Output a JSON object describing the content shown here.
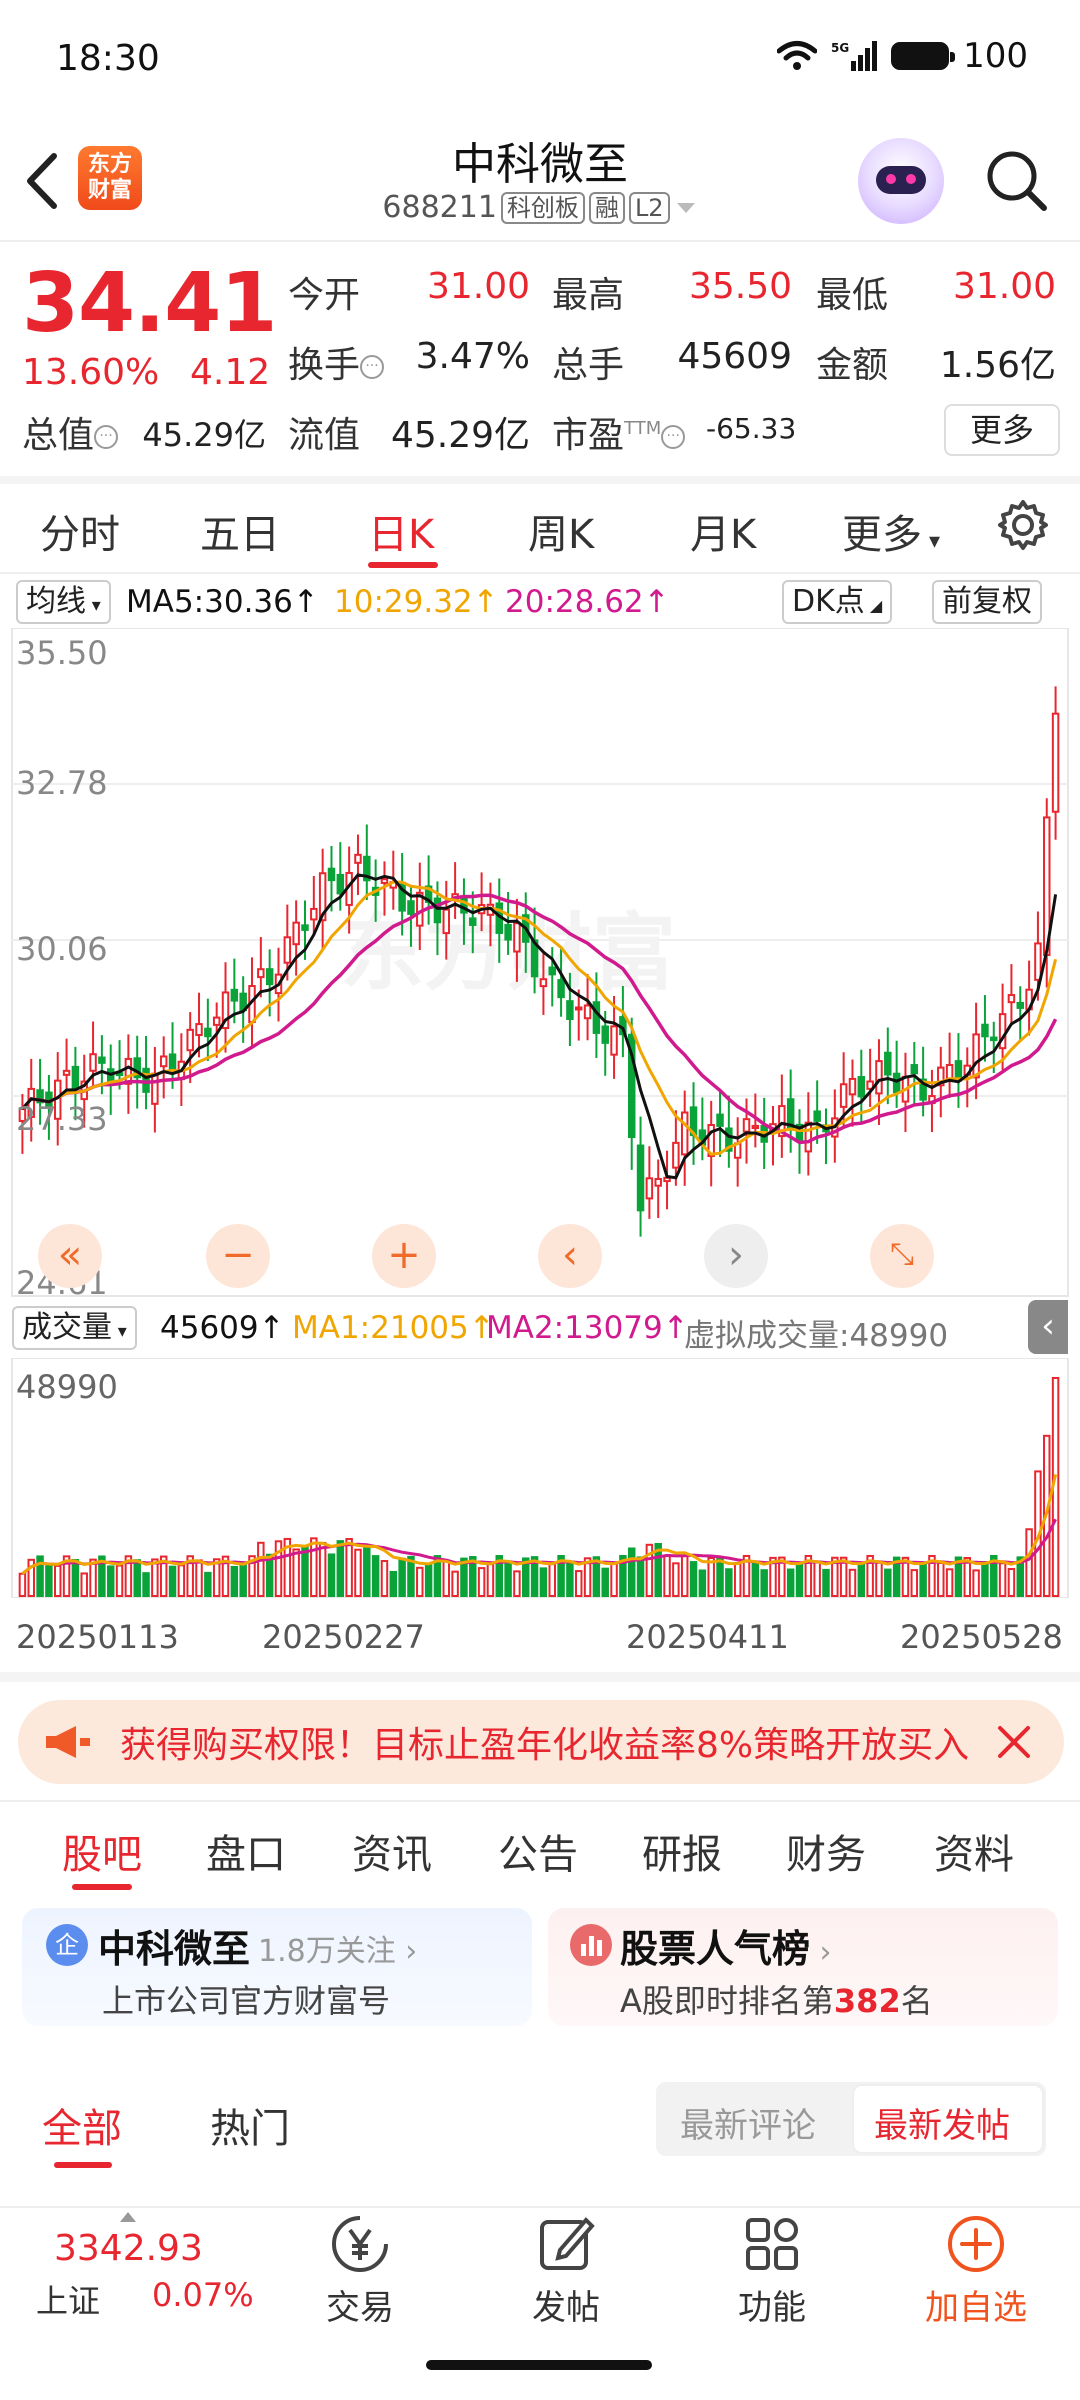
{
  "status_bar": {
    "time": "18:30",
    "network": "5G",
    "battery": "100"
  },
  "header": {
    "logo_text": "东方财富",
    "stock_name": "中科微至",
    "stock_code": "688211",
    "tags": [
      "科创板",
      "融",
      "L2"
    ]
  },
  "quote": {
    "price": "34.41",
    "change_pct": "13.60%",
    "change": "4.12",
    "open_label": "今开",
    "open": "31.00",
    "high_label": "最高",
    "high": "35.50",
    "low_label": "最低",
    "low": "31.00",
    "turnover_label": "换手",
    "turnover": "3.47%",
    "volume_label": "总手",
    "volume": "45609",
    "amount_label": "金额",
    "amount": "1.56亿",
    "mktcap_label": "总值",
    "mktcap": "45.29亿",
    "float_label": "流值",
    "float_cap": "45.29亿",
    "pe_label": "市盈",
    "pe_sup": "TTM",
    "pe": "-65.33",
    "more_label": "更多"
  },
  "period_tabs": [
    "分时",
    "五日",
    "日K",
    "周K",
    "月K",
    "更多"
  ],
  "active_period": "日K",
  "chart": {
    "indicator_label": "均线",
    "ma5": "MA5:30.36↑",
    "ma10": "10:29.32↑",
    "ma20": "20:28.62↑",
    "dk_label": "DK点",
    "adjust_label": "前复权",
    "y_labels": [
      "35.50",
      "32.78",
      "30.06",
      "27.33",
      "24.61"
    ],
    "vol_indicator_label": "成交量",
    "vol_now": "45609↑",
    "vol_ma1": "MA1:21005↑",
    "vol_ma2": "MA2:13079↑",
    "vol_virtual": "虚拟成交量:48990",
    "vol_max": "48990",
    "x_labels": [
      "20250113",
      "20250227",
      "20250411",
      "20250528"
    ],
    "watermark": "东方财富",
    "colors": {
      "up": "#e8262f",
      "down": "#0aa33a",
      "ma5": "#111111",
      "ma10": "#f0a500",
      "ma20": "#d01a8e"
    }
  },
  "chart_data": {
    "type": "candlestick",
    "ylim": [
      24.61,
      35.5
    ],
    "x_range": [
      "20250113",
      "20250528"
    ],
    "latest": {
      "open": 31.0,
      "high": 35.5,
      "low": 31.0,
      "close": 34.41
    }
  },
  "banner": {
    "text": "获得购买权限！目标止盈年化收益率8%策略开放买入"
  },
  "content_tabs": [
    "股吧",
    "盘口",
    "资讯",
    "公告",
    "研报",
    "财务",
    "资料"
  ],
  "active_content_tab": "股吧",
  "cards": {
    "official": {
      "badge": "企",
      "title": "中科微至",
      "follow": "1.8万关注",
      "subtitle": "上市公司官方财富号"
    },
    "rank": {
      "title": "股票人气榜",
      "subtitle_prefix": "A股即时排名第",
      "rank": "382",
      "subtitle_suffix": "名"
    }
  },
  "feed_tabs": [
    "全部",
    "热门"
  ],
  "sort_tabs": [
    "最新评论",
    "最新发帖"
  ],
  "bottom_bar": {
    "index_value": "3342.93",
    "index_name": "上证",
    "index_change": "0.07%",
    "items": [
      "交易",
      "发帖",
      "功能",
      "加自选"
    ]
  }
}
